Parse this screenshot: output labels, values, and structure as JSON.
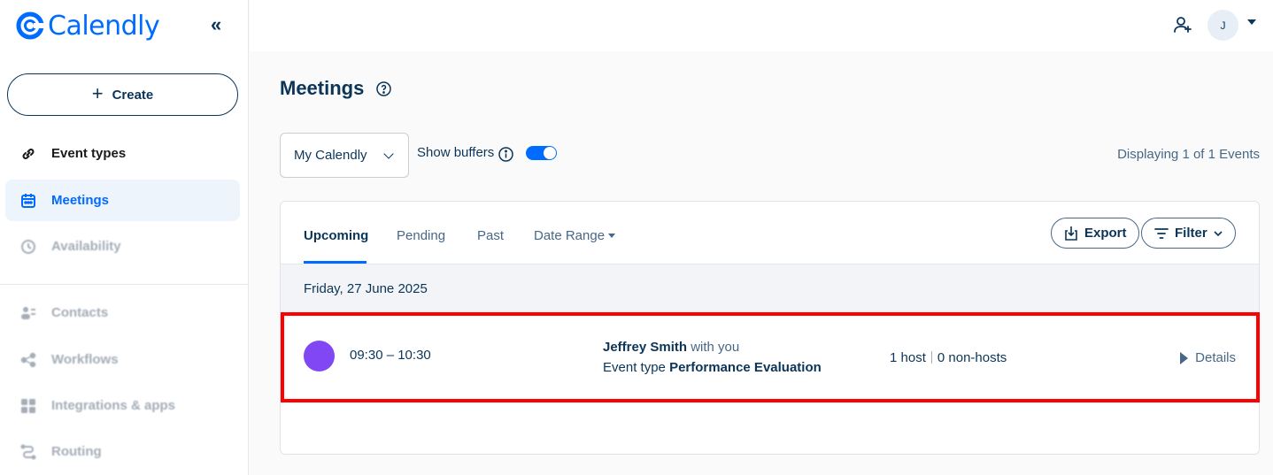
{
  "app": {
    "name": "Calendly"
  },
  "sidebar": {
    "create_label": "Create",
    "items": [
      {
        "label": "Event types",
        "icon": "link-icon"
      },
      {
        "label": "Meetings",
        "icon": "calendar-icon"
      },
      {
        "label": "Availability",
        "icon": "clock-icon"
      },
      {
        "label": "Contacts",
        "icon": "contacts-icon"
      },
      {
        "label": "Workflows",
        "icon": "workflow-icon"
      },
      {
        "label": "Integrations & apps",
        "icon": "grid-icon"
      },
      {
        "label": "Routing",
        "icon": "routing-icon"
      }
    ]
  },
  "topbar": {
    "avatar_initial": "J"
  },
  "page": {
    "title": "Meetings",
    "calendar_select": "My Calendly",
    "show_buffers_label": "Show buffers",
    "show_buffers_on": true,
    "displaying": "Displaying 1 of 1 Events"
  },
  "tabs": [
    {
      "label": "Upcoming",
      "active": true
    },
    {
      "label": "Pending"
    },
    {
      "label": "Past"
    },
    {
      "label": "Date Range"
    }
  ],
  "actions": {
    "export_label": "Export",
    "filter_label": "Filter"
  },
  "date_header": "Friday, 27 June 2025",
  "meeting": {
    "color": "#8247f5",
    "time": "09:30 – 10:30",
    "invitee_name": "Jeffrey Smith",
    "invitee_suffix": "with you",
    "event_type_prefix": "Event type",
    "event_type": "Performance Evaluation",
    "hosts": "1 host",
    "non_hosts": "0 non-hosts",
    "details_label": "Details"
  },
  "colors": {
    "brand": "#006bff",
    "text": "#0b3558",
    "highlight": "#ff0000"
  }
}
